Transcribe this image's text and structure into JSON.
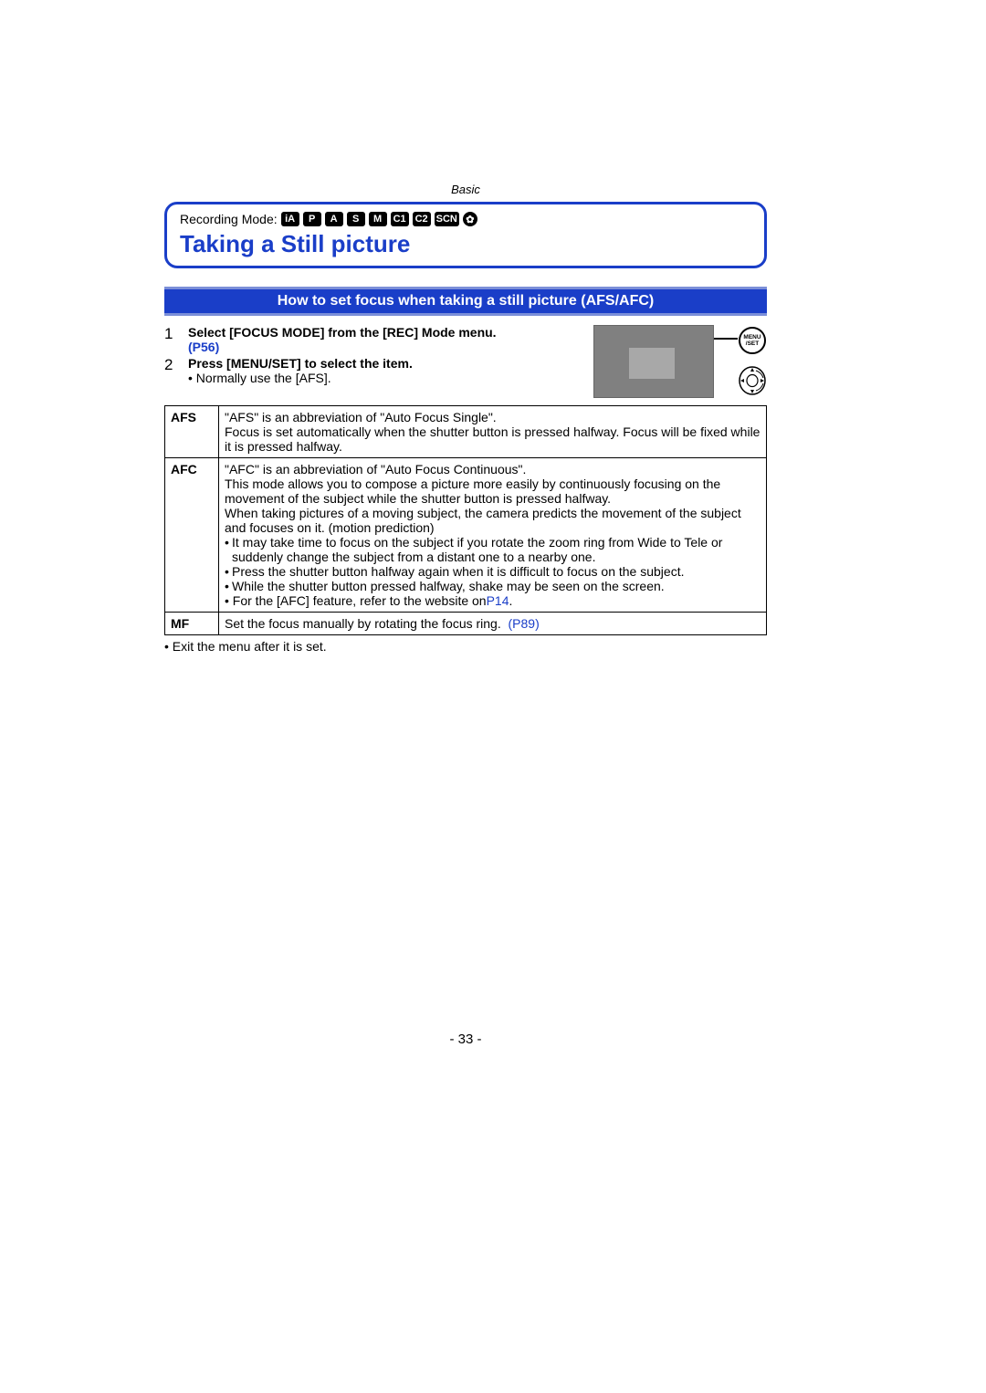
{
  "section": "Basic",
  "recording_label": "Recording Mode:",
  "modes": [
    "iA",
    "P",
    "A",
    "S",
    "M",
    "C1",
    "C2",
    "SCN",
    "✿"
  ],
  "title": "Taking a Still picture",
  "subhead": "How to set focus when taking a still picture (AFS/AFC)",
  "steps": [
    {
      "num": "1",
      "bold": "Select [FOCUS MODE] from the [REC] Mode menu.",
      "link": " (P56)"
    },
    {
      "num": "2",
      "bold": "Press [MENU/SET] to select the item.",
      "note": "• Normally use the [AFS]."
    }
  ],
  "menu_set_top": "MENU",
  "menu_set_bot": "/SET",
  "table": {
    "rows": [
      {
        "key": "AFS",
        "body_lines": [
          "\"AFS\" is an abbreviation of \"Auto Focus Single\".",
          "Focus is set automatically when the shutter button is pressed halfway. Focus will be fixed while it is pressed halfway."
        ]
      },
      {
        "key": "AFC",
        "body_lines": [
          "\"AFC\" is an abbreviation of \"Auto Focus Continuous\".",
          "This mode allows you to compose a picture more easily by continuously focusing on the movement of the subject while the shutter button is pressed halfway.",
          "When taking pictures of a moving subject, the camera predicts the movement of the subject and focuses on it. (motion prediction)"
        ],
        "bullets": [
          "It may take time to focus on the subject if you rotate the zoom ring from Wide to Tele or suddenly change the subject from a distant one to a nearby one.",
          "Press the shutter button halfway again when it is difficult to focus on the subject.",
          "While the shutter button pressed halfway, shake may be seen on the screen."
        ],
        "footer_pre": "• For the [AFC] feature, refer to the website on ",
        "footer_link": "P14",
        "footer_post": "."
      },
      {
        "key": "MF",
        "mf_text": "Set the focus manually by rotating the focus ring.",
        "mf_link": "(P89)"
      }
    ]
  },
  "post_note": "• Exit the menu after it is set.",
  "page_num": "- 33 -"
}
